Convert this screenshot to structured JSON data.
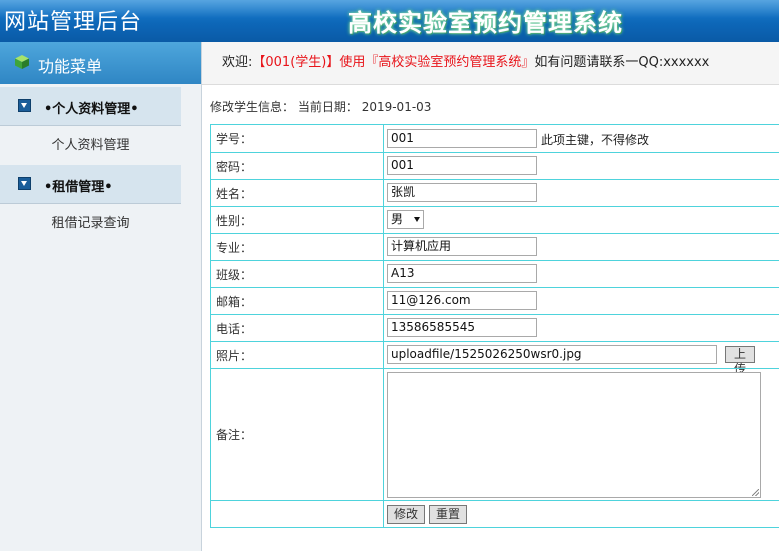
{
  "header": {
    "site_title": "网站管理后台",
    "system_title": "高校实验室预约管理系统"
  },
  "sidebar": {
    "menu_title": "功能菜单",
    "groups": [
      {
        "label": "•个人资料管理•",
        "items": [
          "个人资料管理"
        ]
      },
      {
        "label": "•租借管理•",
        "items": [
          "租借记录查询"
        ]
      }
    ]
  },
  "welcome": {
    "prefix": "欢迎:",
    "user": "【001(学生)】使用『高校实验室预约管理系统』",
    "suffix": "如有问题请联系一QQ:xxxxxx"
  },
  "info": {
    "label": "修改学生信息：",
    "date_label": "当前日期：",
    "date": "2019-01-03"
  },
  "form": {
    "student_id_label": "学号：",
    "student_id": "001",
    "student_id_note": "此项主键，不得修改",
    "password_label": "密码：",
    "password": "001",
    "name_label": "姓名：",
    "name": "张凯",
    "gender_label": "性别：",
    "gender": "男",
    "major_label": "专业：",
    "major": "计算机应用",
    "class_label": "班级：",
    "class": "A13",
    "email_label": "邮箱：",
    "email": "11@126.com",
    "phone_label": "电话：",
    "phone": "13586585545",
    "photo_label": "照片：",
    "photo": "uploadfile/1525026250wsr0.jpg",
    "upload_label": "上传",
    "remark_label": "备注：",
    "remark": "",
    "submit_label": "修改",
    "reset_label": "重置"
  },
  "colors": {
    "header_blue": "#0d67b8",
    "menu_blue": "#2f86c4",
    "table_border": "#4ed3dc",
    "welcome_red": "#e8141a"
  }
}
